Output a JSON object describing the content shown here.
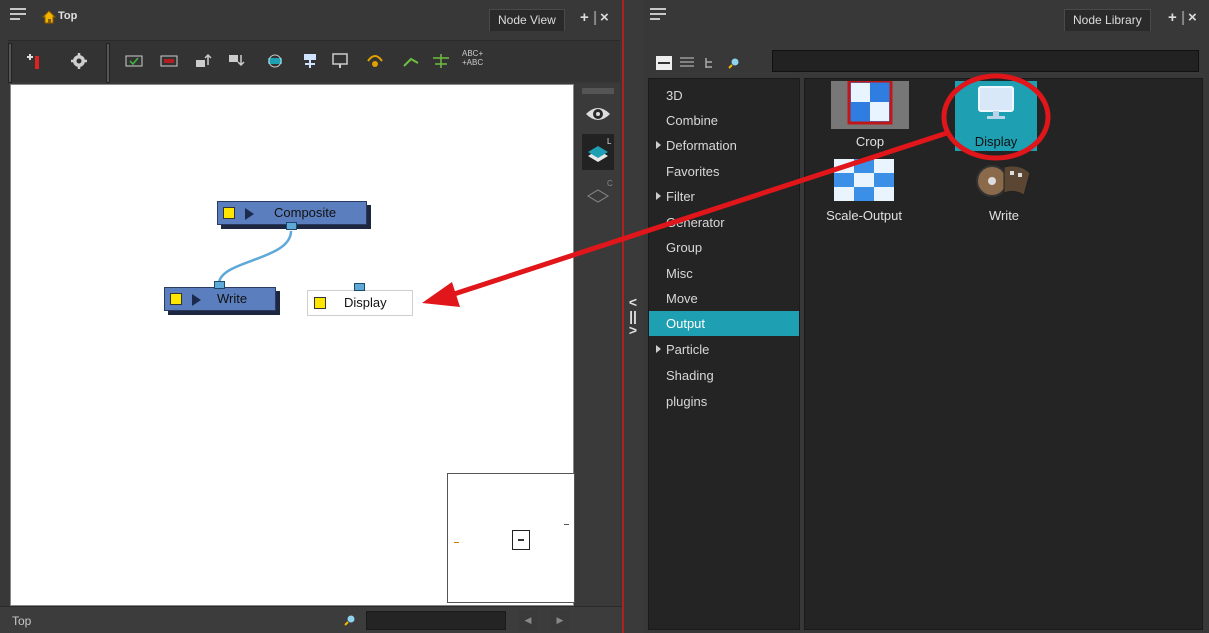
{
  "left_panel": {
    "breadcrumb": "Top",
    "tab_label": "Node View",
    "tab_add": "+",
    "tab_close": "×",
    "toolbar_text_icon": "ABC+ +ABC",
    "nodes": {
      "composite": "Composite",
      "write": "Write",
      "display": "Display"
    },
    "status_text": "Top"
  },
  "right_panel": {
    "tab_label": "Node Library",
    "tab_add": "+",
    "tab_close": "×",
    "categories": [
      {
        "label": "3D",
        "expandable": false
      },
      {
        "label": "Combine",
        "expandable": false
      },
      {
        "label": "Deformation",
        "expandable": true
      },
      {
        "label": "Favorites",
        "expandable": false
      },
      {
        "label": "Filter",
        "expandable": true
      },
      {
        "label": "Generator",
        "expandable": false
      },
      {
        "label": "Group",
        "expandable": false
      },
      {
        "label": "Misc",
        "expandable": false
      },
      {
        "label": "Move",
        "expandable": false
      },
      {
        "label": "Output",
        "expandable": false
      },
      {
        "label": "Particle",
        "expandable": true
      },
      {
        "label": "Shading",
        "expandable": false
      },
      {
        "label": "plugins",
        "expandable": false
      }
    ],
    "selected_category": "Output",
    "library_nodes": [
      "Crop",
      "Display",
      "Scale-Output",
      "Write"
    ],
    "selected_node": "Display"
  },
  "colors": {
    "accent": "#1f9fb2",
    "node_blue": "#5b7fbe",
    "annotation_red": "#e0161a"
  }
}
